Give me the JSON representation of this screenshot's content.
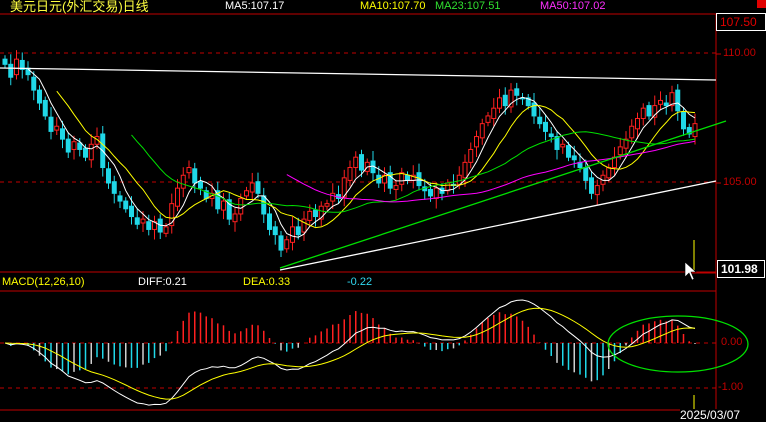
{
  "header": {
    "title": "美元日元(外汇交易)日线",
    "ma5": "MA5:107.17",
    "ma10": "MA10:107.70",
    "ma23": "MA23:107.51",
    "ma50": "MA50:107.02"
  },
  "macd_header": {
    "label": "MACD(12,26,10)",
    "diff": "DIFF:0.21",
    "dea": "DEA:0.33",
    "macd": "-0.22"
  },
  "price_axis": {
    "top_label": "107.50",
    "ticks": [
      "110.00",
      "105.00"
    ],
    "cursor_price": "101.98"
  },
  "macd_axis": {
    "ticks": [
      "0.00",
      "-1.00"
    ]
  },
  "date_label": "2025/03/07",
  "colors": {
    "up": "#ff2020",
    "down": "#20d8e8",
    "ma5": "#ffffff",
    "ma10": "#ffff00",
    "ma23": "#00e000",
    "ma50": "#ff00ff",
    "grid": "#c00000"
  },
  "chart_data": {
    "type": "candlestick",
    "title": "美元日元(外汇交易)日线",
    "ylim": [
      101.6,
      111.5
    ],
    "yticks": [
      110,
      105
    ],
    "closes": [
      109.6,
      109.1,
      109.8,
      109.4,
      109.2,
      108.6,
      108.1,
      107.6,
      107.0,
      107.2,
      106.7,
      106.2,
      106.6,
      106.3,
      106.0,
      106.5,
      106.8,
      105.6,
      105.0,
      104.6,
      104.3,
      104.0,
      103.7,
      103.4,
      103.6,
      103.2,
      103.5,
      103.1,
      103.3,
      104.2,
      104.8,
      105.3,
      105.6,
      105.0,
      104.8,
      104.4,
      104.6,
      104.0,
      104.3,
      103.6,
      103.8,
      104.4,
      104.7,
      105.0,
      104.6,
      103.8,
      103.2,
      103.0,
      102.4,
      102.8,
      103.3,
      103.0,
      103.6,
      103.9,
      103.7,
      104.1,
      104.2,
      104.6,
      104.4,
      105.2,
      105.6,
      106.0,
      105.5,
      105.8,
      105.4,
      105.0,
      105.3,
      104.8,
      104.9,
      105.4,
      105.1,
      105.3,
      104.9,
      104.7,
      104.5,
      104.8,
      104.6,
      105.0,
      104.9,
      105.3,
      105.8,
      106.3,
      106.8,
      107.3,
      107.6,
      107.9,
      108.3,
      108.0,
      108.6,
      108.4,
      108.3,
      108.0,
      107.6,
      107.3,
      107.0,
      106.8,
      106.3,
      106.5,
      106.0,
      105.9,
      105.6,
      105.1,
      104.6,
      104.9,
      105.3,
      105.6,
      106.0,
      106.4,
      106.7,
      107.2,
      107.5,
      107.9,
      107.6,
      108.0,
      108.2,
      108.0,
      108.5,
      107.8,
      107.1,
      106.9,
      107.3
    ],
    "moving_averages": [
      5,
      10,
      23,
      50
    ],
    "macd": {
      "params": [
        12,
        26,
        10
      ],
      "diff": 0.21,
      "dea": 0.33,
      "macd": -0.22,
      "ylim": [
        -1.3,
        1.2
      ],
      "yticks": [
        0,
        -1
      ]
    }
  }
}
